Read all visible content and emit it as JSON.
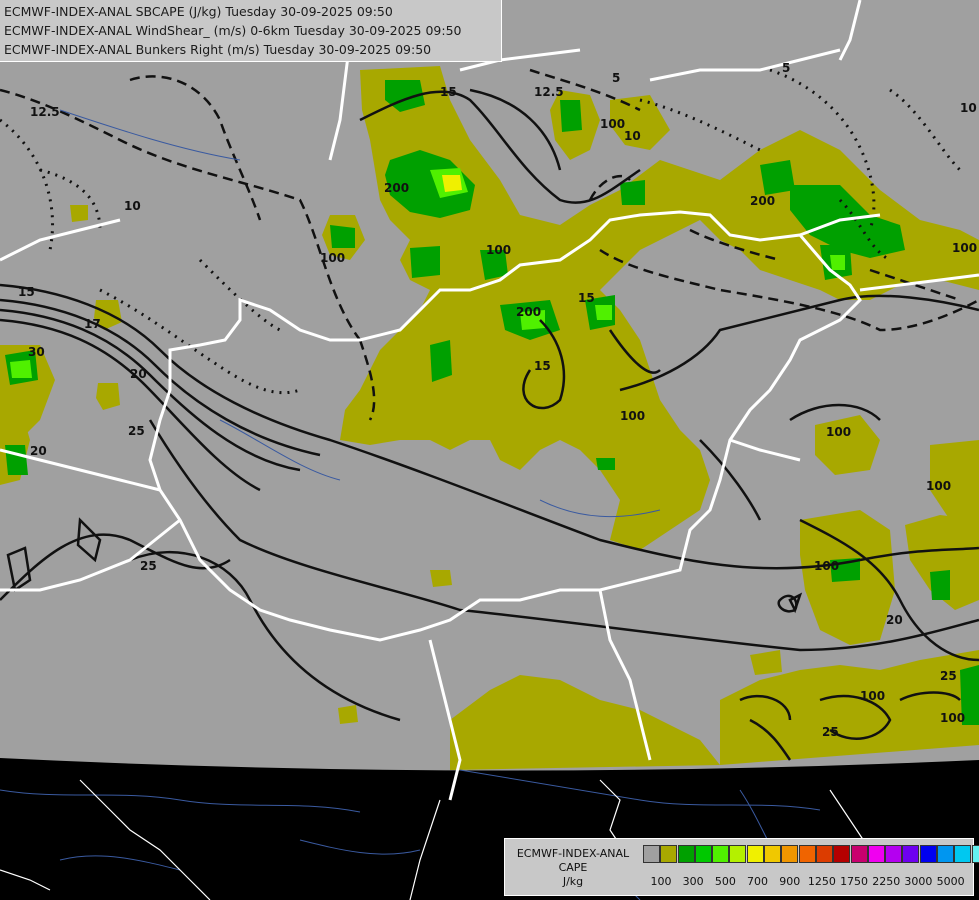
{
  "header": {
    "line1": "ECMWF-INDEX-ANAL SBCAPE (J/kg) Tuesday 30-09-2025 09:50",
    "line2": "ECMWF-INDEX-ANAL WindShear_ (m/s) 0-6km Tuesday 30-09-2025 09:50",
    "line3": "ECMWF-INDEX-ANAL Bunkers Right (m/s) Tuesday 30-09-2025 09:50"
  },
  "legend": {
    "title_line1": "ECMWF-INDEX-ANAL",
    "title_line2": "CAPE",
    "title_line3": "J/kg",
    "colors": [
      "#a0a0a0",
      "#a8a800",
      "#00a000",
      "#00c800",
      "#50f000",
      "#b4f000",
      "#f0f000",
      "#f0c800",
      "#f09600",
      "#f06400",
      "#dc3c00",
      "#b40000",
      "#c8006e",
      "#f000f0",
      "#b400f0",
      "#6e00f0",
      "#0000f0",
      "#0096f0",
      "#00c8f0",
      "#64f0f0",
      "#ffffff"
    ],
    "tick_labels": [
      "100",
      "300",
      "500",
      "700",
      "900",
      "1250",
      "1750",
      "2250",
      "3000",
      "5000"
    ]
  },
  "map": {
    "domain_fill": "#a0a0a0",
    "cape_low_color": "#a8a800",
    "cape_mid_color": "#00a000",
    "cape_high_color": "#00c800",
    "cape_peak_color": "#b4f000",
    "border_color": "#ffffff",
    "contour_labels": [
      "12.5",
      "10",
      "15",
      "17",
      "20",
      "25",
      "30",
      "100",
      "200",
      "12.5",
      "5",
      "15",
      "100",
      "200",
      "100",
      "15",
      "15",
      "100",
      "20",
      "25",
      "10",
      "100",
      "10",
      "200",
      "5",
      "100",
      "100",
      "25",
      "20",
      "25",
      "100",
      "100",
      "100"
    ]
  }
}
